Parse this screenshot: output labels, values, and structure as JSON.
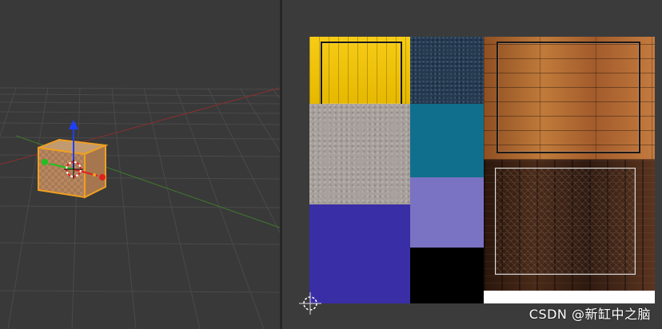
{
  "watermark": {
    "text": "CSDN @新缸中之脑"
  },
  "colors": {
    "viewport_bg": "#393939",
    "grid_line": "#4a4a4a",
    "axis_x": "#8a2f2f",
    "axis_y": "#3f7a2f",
    "selection_orange": "#f0a020",
    "gizmo_blue": "#1f3fff",
    "gizmo_green": "#20c020",
    "gizmo_red": "#e02020",
    "tile_yellow": "#f0c000",
    "tile_blue_noise": "#233a52",
    "tile_gray_noise": "#a7a09c",
    "tile_teal": "#0f6f8c",
    "tile_lavender": "#7a72c2",
    "tile_indigo": "#3a2ea6",
    "tile_black": "#000000",
    "tile_wood_light": "#b06a34",
    "tile_wood_dark": "#3b2416",
    "white_strip": "#ffffff"
  },
  "icons": {
    "uv_cursor": "crosshair-icon",
    "origin_cursor": "3d-cursor-icon"
  }
}
